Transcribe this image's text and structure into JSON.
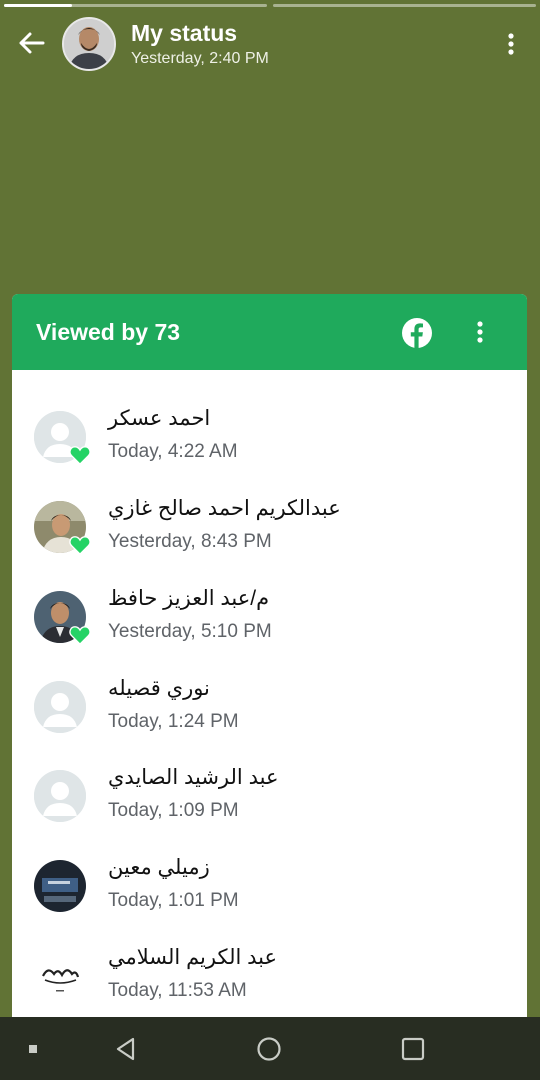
{
  "status_header": {
    "title": "My status",
    "timestamp": "Yesterday, 2:40 PM",
    "progress": [
      0.26,
      0
    ]
  },
  "viewers_panel": {
    "title": "Viewed by 73",
    "accent_color": "#1faa5c",
    "share_icon": "facebook-icon",
    "viewers": [
      {
        "name": "احمد عسكر",
        "time": "Today, 4:22 AM",
        "avatar": "default",
        "liked": true
      },
      {
        "name": "عبدالكريم احمد صالح غازي",
        "time": "Yesterday, 8:43 PM",
        "avatar": "photo",
        "liked": true
      },
      {
        "name": "م/عبد العزيز حافظ",
        "time": "Yesterday, 5:10 PM",
        "avatar": "photo",
        "liked": true
      },
      {
        "name": "نوري قصيله",
        "time": "Today, 1:24 PM",
        "avatar": "default",
        "liked": false
      },
      {
        "name": "عبد الرشيد الصايدي",
        "time": "Today, 1:09 PM",
        "avatar": "default",
        "liked": false
      },
      {
        "name": "زميلي معين",
        "time": "Today, 1:01 PM",
        "avatar": "photo",
        "liked": false
      },
      {
        "name": "عبد الكريم السلامي",
        "time": "Today, 11:53 AM",
        "avatar": "calligraphy",
        "liked": false
      }
    ]
  },
  "colors": {
    "status_background": "#617335",
    "like_heart": "#25d366"
  },
  "navigation_bar": {
    "items": [
      "dot-icon",
      "back-triangle-icon",
      "home-circle-icon",
      "recents-square-icon"
    ]
  }
}
